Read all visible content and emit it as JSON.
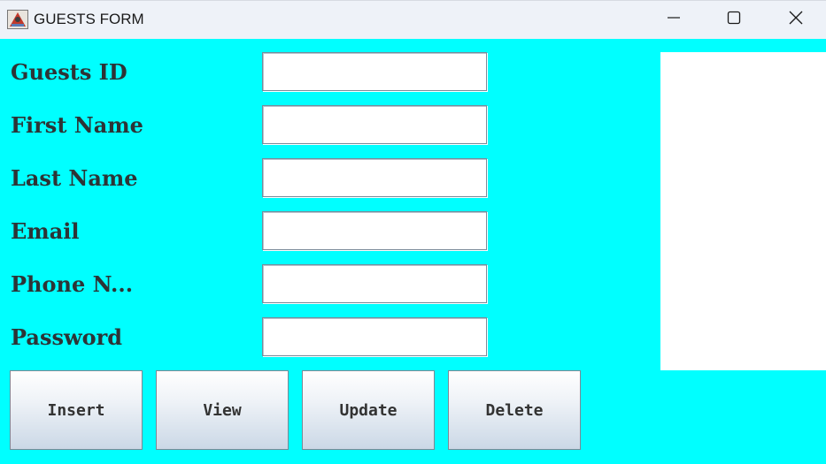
{
  "window": {
    "title": "GUESTS FORM"
  },
  "icons": {
    "app": "java-app-icon",
    "minimize": "minimize-icon",
    "maximize": "maximize-icon",
    "close": "close-icon"
  },
  "colors": {
    "form_background": "#00ffff",
    "titlebar_background": "#eef2f8",
    "label_text": "#2d3436",
    "panel": "#ffffff"
  },
  "form": {
    "fields": [
      {
        "label": "Guests ID",
        "value": ""
      },
      {
        "label": "First Name",
        "value": ""
      },
      {
        "label": "Last Name",
        "value": ""
      },
      {
        "label": "Email",
        "value": ""
      },
      {
        "label": "Phone N...",
        "value": ""
      },
      {
        "label": "Password",
        "value": ""
      }
    ]
  },
  "buttons": {
    "insert": "Insert",
    "view": "View",
    "update": "Update",
    "delete": "Delete"
  }
}
